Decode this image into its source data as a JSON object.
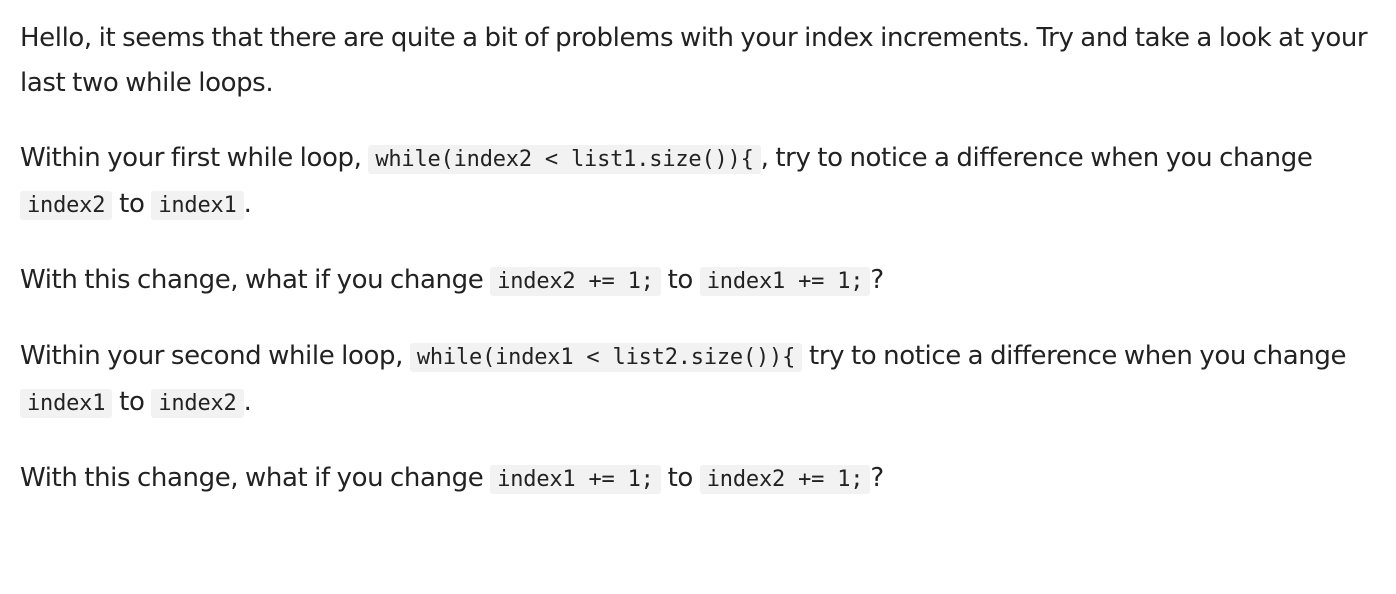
{
  "post": {
    "p1": {
      "text": "Hello, it seems that there are quite a bit of problems with your index increments. Try and take a look at your last two while loops."
    },
    "p2": {
      "t1": "Within your first while loop, ",
      "c1": "while(index2 < list1.size()){",
      "t2": ", try to notice a difference when you change ",
      "c2": "index2",
      "t3": " to ",
      "c3": "index1",
      "t4": "."
    },
    "p3": {
      "t1": "With this change, what if you change ",
      "c1": "index2 += 1;",
      "t2": " to ",
      "c2": "index1 += 1;",
      "t3": "?"
    },
    "p4": {
      "t1": "Within your second while loop, ",
      "c1": "while(index1 < list2.size()){",
      "t2": " try to notice a difference when you change ",
      "c2": "index1",
      "t3": " to ",
      "c3": "index2",
      "t4": "."
    },
    "p5": {
      "t1": "With this change, what if you change ",
      "c1": "index1 += 1;",
      "t2": " to ",
      "c2": "index2 += 1;",
      "t3": "?"
    }
  }
}
